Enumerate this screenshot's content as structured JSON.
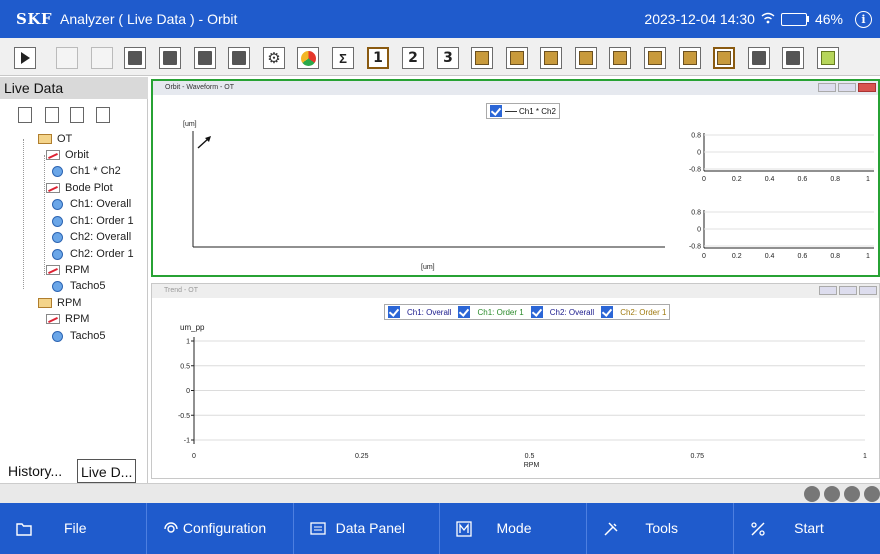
{
  "titlebar": {
    "brand": "SKF",
    "app_title": "Analyzer ( Live Data ) - Orbit",
    "datetime": "2023-12-04 14:30",
    "battery_level": 0.46,
    "battery_text": "46%",
    "info_glyph": "i"
  },
  "toolbar": {
    "buttons": [
      "play-icon",
      "pause-icon",
      "stop-icon",
      "folder-add-icon",
      "folder-open-icon",
      "save-icon",
      "report-icon",
      "settings-icon",
      "pie-chart-icon",
      "sigma-icon",
      "1",
      "2",
      "3",
      "lock-icon",
      "chart-icon",
      "spectrum-icon",
      "bar-spectrum-icon",
      "waterfall-icon",
      "trend-icon",
      "histogram-icon",
      "active-panel-icon",
      "split-horizontal-icon",
      "split-vertical-icon",
      "close-panel-icon"
    ]
  },
  "left_panel": {
    "title": "Live Data",
    "tree": [
      {
        "label": "OT",
        "icon": "folder-icon",
        "level": 0
      },
      {
        "label": "Orbit",
        "icon": "plot-icon",
        "level": 1
      },
      {
        "label": "Ch1 * Ch2",
        "icon": "measurement-icon",
        "level": 2
      },
      {
        "label": "Bode Plot",
        "icon": "plot-icon",
        "level": 1
      },
      {
        "label": "Ch1: Overall",
        "icon": "measurement-icon",
        "level": 2
      },
      {
        "label": "Ch1: Order 1",
        "icon": "measurement-icon",
        "level": 2
      },
      {
        "label": "Ch2: Overall",
        "icon": "measurement-icon",
        "level": 2
      },
      {
        "label": "Ch2: Order 1",
        "icon": "measurement-icon",
        "level": 2
      },
      {
        "label": "RPM",
        "icon": "plot-icon",
        "level": 1
      },
      {
        "label": "Tacho5",
        "icon": "measurement-icon",
        "level": 2
      },
      {
        "label": "RPM",
        "icon": "folder-icon",
        "level": 0
      },
      {
        "label": "RPM",
        "icon": "plot-icon",
        "level": 1
      },
      {
        "label": "Tacho5",
        "icon": "measurement-icon",
        "level": 2
      }
    ],
    "tabs": [
      "History...",
      "Live D..."
    ]
  },
  "orbit_window": {
    "title": "Orbit - Waveform - OT",
    "legend": "Ch1 * Ch2",
    "orbit_y_unit": "[um]",
    "orbit_x_unit": "[um]",
    "mini_top": {
      "y_ticks": [
        "0.8",
        "0",
        "-0.8"
      ],
      "x_ticks": [
        "0",
        "0.2",
        "0.4",
        "0.6",
        "0.8",
        "1"
      ]
    },
    "mini_bottom": {
      "y_ticks": [
        "0.8",
        "0",
        "-0.8"
      ],
      "x_ticks": [
        "0",
        "0.2",
        "0.4",
        "0.6",
        "0.8",
        "1"
      ]
    }
  },
  "trend_window": {
    "title": "Trend - OT",
    "legend": [
      {
        "label": "Ch1: Overall",
        "color": "#1a1a8c"
      },
      {
        "label": "Ch1: Order 1",
        "color": "#2a8a2a"
      },
      {
        "label": "Ch2: Overall",
        "color": "#1a1a8c"
      },
      {
        "label": "Ch2: Order 1",
        "color": "#a07a10"
      }
    ]
  },
  "chart_data": {
    "type": "line",
    "ylabel": "um_pp",
    "xlabel": "RPM",
    "ylim": [
      -1,
      1
    ],
    "xlim": [
      0,
      1
    ],
    "y_ticks": [
      "1",
      "0.5",
      "0",
      "-0.5",
      "-1"
    ],
    "x_ticks": [
      "0",
      "0.25",
      "0.5",
      "0.75",
      "1"
    ],
    "grid": true,
    "series": [
      {
        "name": "Ch1: Overall",
        "values": []
      },
      {
        "name": "Ch1: Order 1",
        "values": []
      },
      {
        "name": "Ch2: Overall",
        "values": []
      },
      {
        "name": "Ch2: Order 1",
        "values": []
      }
    ]
  },
  "bottom_bar": [
    {
      "label": "File",
      "icon": "folder-icon"
    },
    {
      "label": "Configuration",
      "icon": "configuration-icon"
    },
    {
      "label": "Data Panel",
      "icon": "data-panel-icon"
    },
    {
      "label": "Mode",
      "icon": "mode-icon"
    },
    {
      "label": "Tools",
      "icon": "tools-icon"
    },
    {
      "label": "Start",
      "icon": "start-icon"
    }
  ],
  "colors": {
    "brand_blue": "#1f5bcc",
    "active_border": "#27a234",
    "checkbox_blue": "#2b66d6"
  }
}
